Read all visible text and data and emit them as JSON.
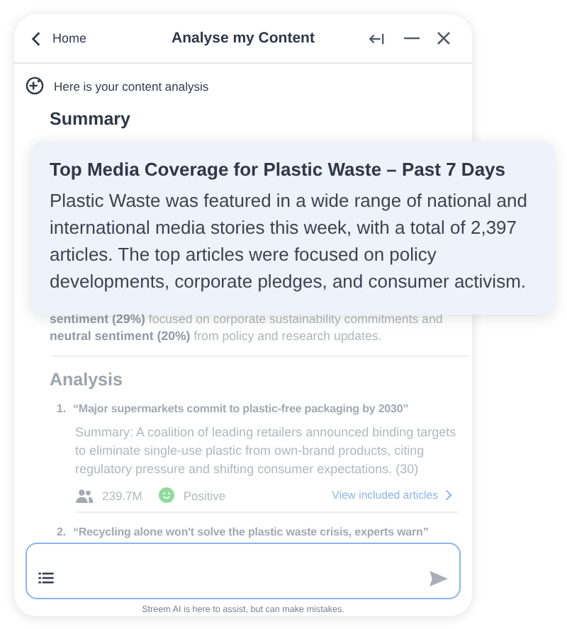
{
  "header": {
    "back": "Home",
    "title": "Analyse my Content"
  },
  "intro": "Here is your content analysis",
  "summary": {
    "heading": "Summary",
    "text": "**sentiment (29%)** focused on corporate sustainability commitments and **neutral sentiment (20%)** from policy and research updates."
  },
  "callout": {
    "title": "Top Media Coverage for Plastic Waste – Past 7 Days",
    "body": "Plastic Waste was featured in a wide range of national and international media stories this week, with a total of 2,397 articles. The top articles were focused on policy developments, corporate pledges, and consumer activism."
  },
  "analysis": {
    "heading": "Analysis",
    "items": [
      {
        "number": "1.",
        "title": "“Major supermarkets commit to plastic-free packaging by 2030”",
        "summary": "Summary: A coalition of leading retailers announced binding targets to eliminate single-use plastic from own-brand products, citing regulatory pressure and shifting consumer expectations. (30)",
        "reach": "239.7M",
        "sentiment": "Positive",
        "link": "View included articles"
      },
      {
        "number": "2.",
        "title": "“Recycling alone won't solve the plastic waste crisis, experts warn”"
      }
    ]
  },
  "footer": "Streem AI is here to assist, but can make mistakes."
}
